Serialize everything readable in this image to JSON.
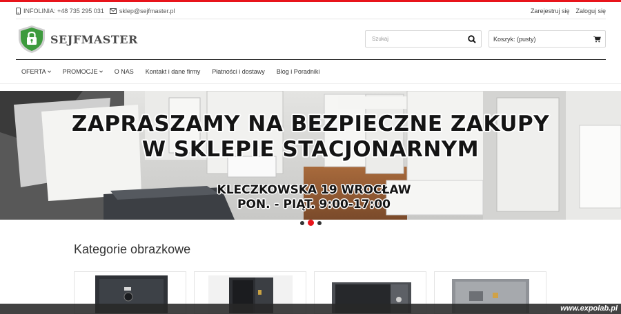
{
  "topbar": {
    "phone": "INFOLINIA: +48 735 295 031",
    "email": "sklep@sejfmaster.pl",
    "register": "Zarejestruj się",
    "login": "Zaloguj się"
  },
  "brand": {
    "name": "SEJFMASTER"
  },
  "search": {
    "placeholder": "Szukaj"
  },
  "cart": {
    "label": "Koszyk: (pusty)"
  },
  "nav": {
    "items": [
      {
        "label": "OFERTA",
        "dropdown": true
      },
      {
        "label": "PROMOCJE",
        "dropdown": true
      },
      {
        "label": "O NAS",
        "dropdown": false
      },
      {
        "label": "Kontakt i dane firmy",
        "dropdown": false
      },
      {
        "label": "Płatności i dostawy",
        "dropdown": false
      },
      {
        "label": "Blog i Poradniki",
        "dropdown": false
      }
    ]
  },
  "banner": {
    "headline_line1": "ZAPRASZAMY NA BEZPIECZNE ZAKUPY",
    "headline_line2": "W SKLEPIE STACJONARNYM",
    "address": "KLECZKOWSKA 19 WROCŁAW",
    "hours": "PON. - PIĄT. 9:00-17:00",
    "slides": 3,
    "active_slide": 2
  },
  "categories": {
    "title": "Kategorie obrazkowe"
  },
  "watermark": "www.expolab.pl",
  "colors": {
    "accent": "#e8141b",
    "logo_green": "#3d9a3d"
  }
}
